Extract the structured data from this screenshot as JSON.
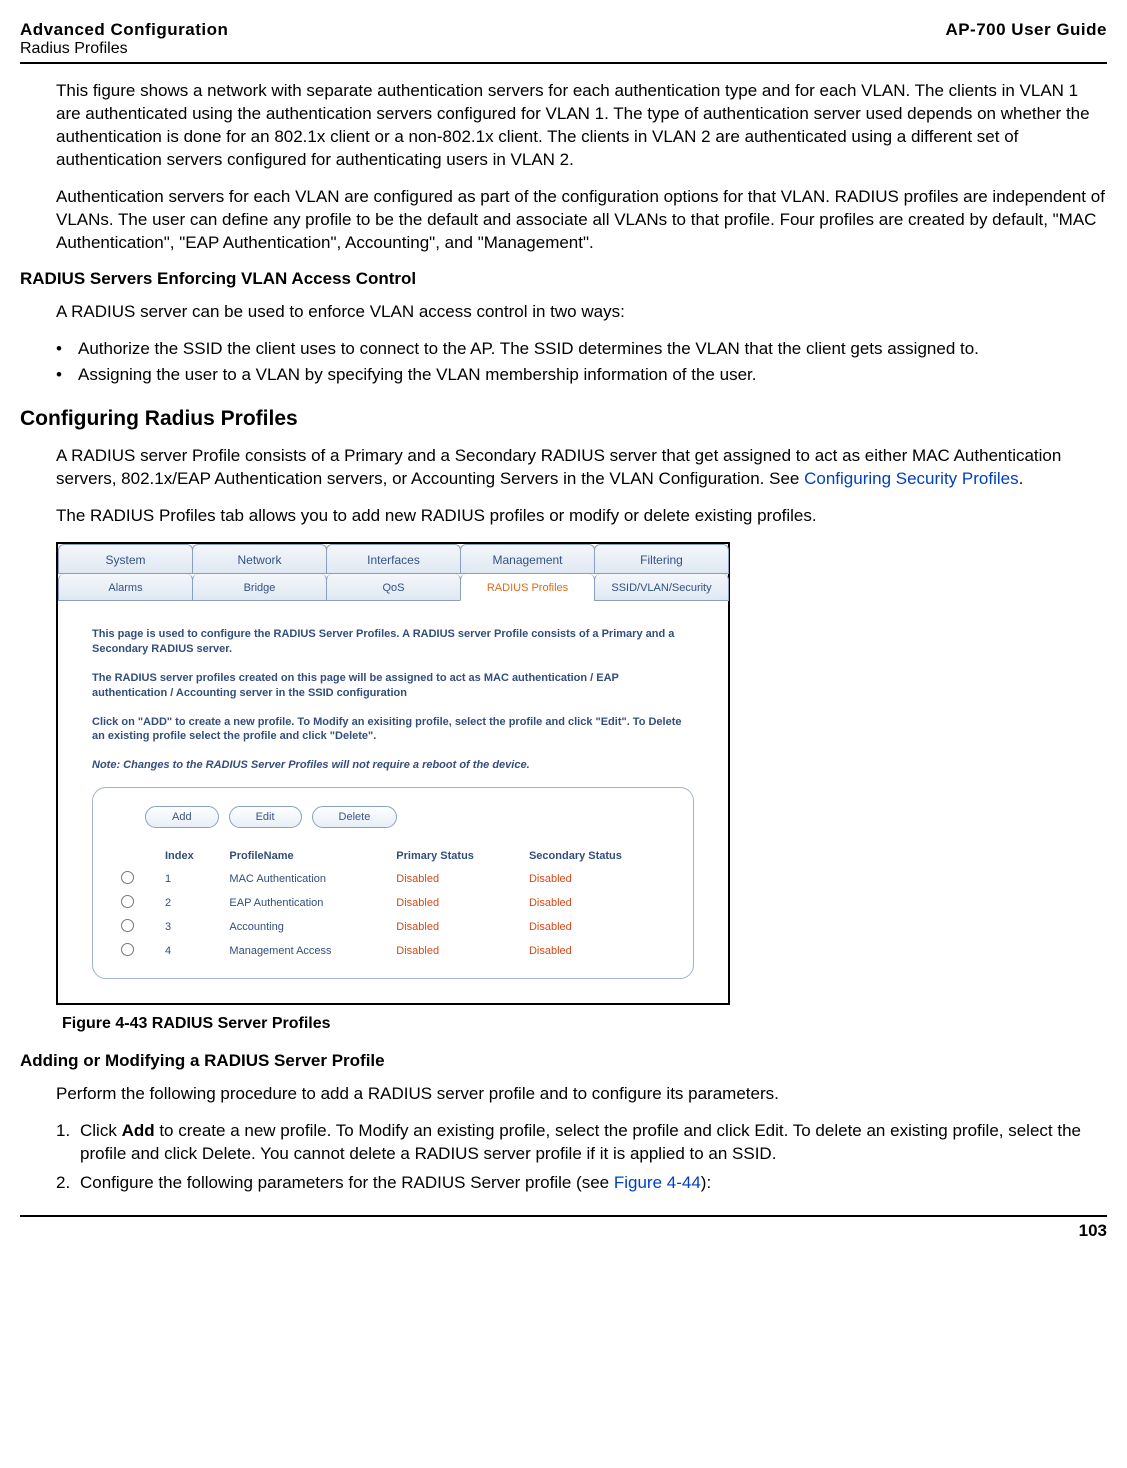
{
  "header": {
    "title": "Advanced Configuration",
    "subtitle": "Radius Profiles",
    "guide": "AP-700 User Guide"
  },
  "para1": "This figure shows a network with separate authentication servers for each authentication type and for each VLAN. The clients in VLAN 1 are authenticated using the authentication servers configured for VLAN 1. The type of authentication server used depends on whether the authentication is done for an 802.1x client or a non-802.1x client. The clients in VLAN 2 are authenticated using a different set of authentication servers configured for authenticating users in VLAN 2.",
  "para2": "Authentication servers for each VLAN are configured as part of the configuration options for that VLAN. RADIUS profiles are independent of VLANs. The user can define any profile to be the default and associate all VLANs to that profile. Four profiles are created by default, \"MAC Authentication\", \"EAP Authentication\", Accounting\", and \"Management\".",
  "h3a": "RADIUS Servers Enforcing VLAN Access Control",
  "para3": " A RADIUS server can be used to enforce VLAN access control in two ways:",
  "bullets_a": [
    "Authorize the SSID the client uses to connect to the AP. The SSID determines the VLAN that the client gets assigned to.",
    "Assigning the user to a VLAN by specifying the VLAN membership information of the user."
  ],
  "h2a": "Configuring Radius Profiles",
  "para4a": "A RADIUS server Profile consists of a Primary and a Secondary RADIUS server that get assigned to act as either MAC Authentication servers, 802.1x/EAP Authentication servers, or Accounting Servers in the VLAN Configuration. See ",
  "para4_link": "Configuring Security Profiles",
  "para4b": ".",
  "para5": "The RADIUS Profiles tab allows you to add new RADIUS profiles or modify or delete existing profiles.",
  "screenshot": {
    "tabs_top": [
      "System",
      "Network",
      "Interfaces",
      "Management",
      "Filtering"
    ],
    "tabs_bottom": [
      "Alarms",
      "Bridge",
      "QoS",
      "RADIUS Profiles",
      "SSID/VLAN/Security"
    ],
    "active_bottom_index": 3,
    "info1": "This page is used to configure the RADIUS Server Profiles. A RADIUS server Profile consists of a Primary and a Secondary RADIUS server.",
    "info2": "The RADIUS server profiles created on this page will be assigned to act as MAC authentication / EAP authentication / Accounting server in the SSID configuration",
    "info3": "Click on \"ADD\" to create a new profile. To Modify an exisiting profile, select the profile and click \"Edit\". To Delete an existing profile select the profile and click \"Delete\".",
    "info4": "Note: Changes to the RADIUS Server Profiles will not require a reboot of the device.",
    "buttons": {
      "add": "Add",
      "edit": "Edit",
      "delete": "Delete"
    },
    "columns": {
      "index": "Index",
      "name": "ProfileName",
      "primary": "Primary Status",
      "secondary": "Secondary Status"
    },
    "rows": [
      {
        "index": "1",
        "name": "MAC Authentication",
        "primary": "Disabled",
        "secondary": "Disabled"
      },
      {
        "index": "2",
        "name": "EAP Authentication",
        "primary": "Disabled",
        "secondary": "Disabled"
      },
      {
        "index": "3",
        "name": "Accounting",
        "primary": "Disabled",
        "secondary": "Disabled"
      },
      {
        "index": "4",
        "name": "Management Access",
        "primary": "Disabled",
        "secondary": "Disabled"
      }
    ]
  },
  "figure_caption": "Figure 4-43 RADIUS Server Profiles",
  "h3b": "Adding or Modifying a RADIUS Server Profile",
  "para6": "Perform the following procedure to add a RADIUS server profile and to configure its parameters.",
  "steps": [
    {
      "num": "1.",
      "pre": "Click ",
      "bold": "Add",
      "post": " to create a new profile. To Modify an existing profile, select the profile and click Edit. To delete an existing profile, select the profile and click Delete. You cannot delete a RADIUS server profile if it is applied to an SSID."
    },
    {
      "num": "2.",
      "pre": "Configure the following parameters for the RADIUS Server profile (see ",
      "link": "Figure 4-44",
      "post": "):"
    }
  ],
  "page_number": "103"
}
